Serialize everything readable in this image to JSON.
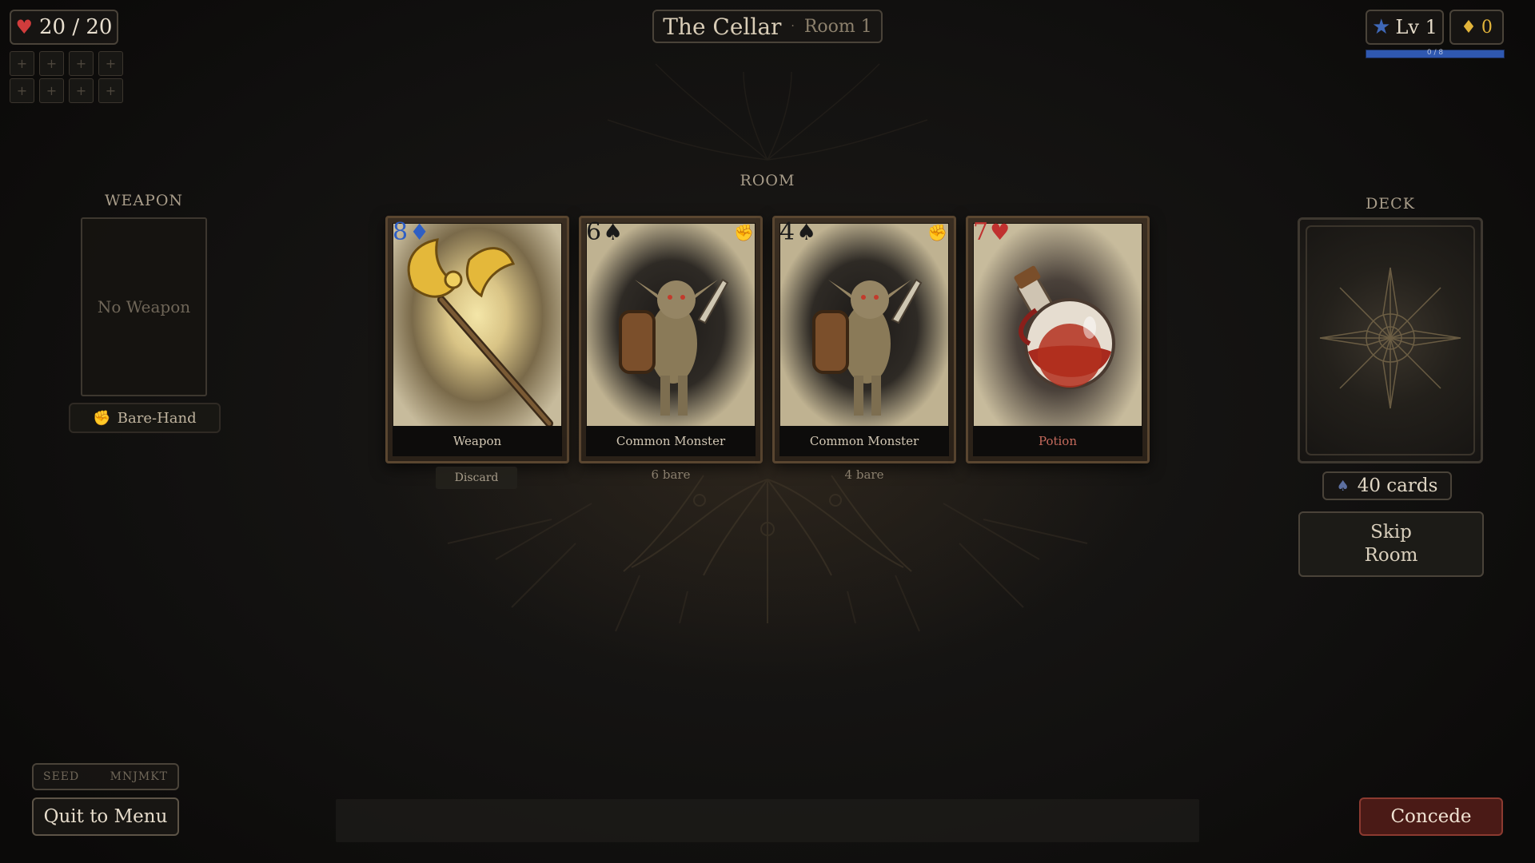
{
  "hud": {
    "hp_text": "20 / 20",
    "level_text": "Lv 1",
    "gold_text": "0",
    "xp_text": "0 / 8",
    "xp_fraction": 0.0,
    "buff_slots": [
      "+",
      "+",
      "+",
      "+",
      "+",
      "+",
      "+",
      "+"
    ]
  },
  "header": {
    "dungeon": "The Cellar",
    "separator": "·",
    "room": "Room 1"
  },
  "weapon": {
    "label": "WEAPON",
    "empty_text": "No Weapon",
    "bare_hand": "Bare-Hand"
  },
  "room": {
    "label": "ROOM",
    "cards": [
      {
        "rank": "8",
        "suit": "♦",
        "suit_color": "#2f5fc4",
        "rank_color": "#2f5fc4",
        "caption": "Weapon",
        "caption_color": "#d2c7b4",
        "art": "golden-axe",
        "has_fist": false
      },
      {
        "rank": "6",
        "suit": "♠",
        "suit_color": "#1a1a1a",
        "rank_color": "#1a1a1a",
        "caption": "Common Monster",
        "caption_color": "#d2c7b4",
        "art": "goblin",
        "has_fist": true
      },
      {
        "rank": "4",
        "suit": "♠",
        "suit_color": "#1a1a1a",
        "rank_color": "#1a1a1a",
        "caption": "Common Monster",
        "caption_color": "#d2c7b4",
        "art": "goblin",
        "has_fist": true
      },
      {
        "rank": "7",
        "suit": "♥",
        "suit_color": "#c0312f",
        "rank_color": "#c0312f",
        "caption": "Potion",
        "caption_color": "#c56a5c",
        "art": "potion",
        "has_fist": false
      }
    ],
    "discard_label": "Discard",
    "monster_notes": [
      "6 bare",
      "4 bare"
    ]
  },
  "deck": {
    "label": "DECK",
    "count_text": "40 cards",
    "skip_label": "Skip\nRoom"
  },
  "footer": {
    "seed_label": "SEED",
    "seed_value": "MNJMKT",
    "quit_label": "Quit to Menu",
    "concede_label": "Concede"
  },
  "colors": {
    "heart": "#d13c3c",
    "star": "#3f68b8",
    "gold": "#e2b43a",
    "concede_bg": "#4a1a16"
  }
}
